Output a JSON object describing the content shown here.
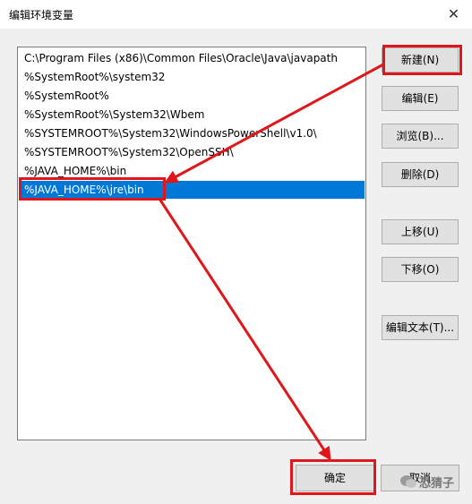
{
  "window": {
    "title": "编辑环境变量",
    "close_glyph": "✕"
  },
  "list": {
    "items": [
      "C:\\Program Files (x86)\\Common Files\\Oracle\\Java\\javapath",
      "%SystemRoot%\\system32",
      "%SystemRoot%",
      "%SystemRoot%\\System32\\Wbem",
      "%SYSTEMROOT%\\System32\\WindowsPowerShell\\v1.0\\",
      "%SYSTEMROOT%\\System32\\OpenSSH\\",
      "%JAVA_HOME%\\bin",
      "%JAVA_HOME%\\jre\\bin"
    ],
    "selected_index": 7
  },
  "buttons": {
    "new": "新建(N)",
    "edit": "编辑(E)",
    "browse": "浏览(B)...",
    "delete": "删除(D)",
    "move_up": "上移(U)",
    "move_down": "下移(O)",
    "edit_text": "编辑文本(T)...",
    "ok": "确定",
    "cancel": "取消"
  },
  "watermark": {
    "text": "恐猜子"
  },
  "colors": {
    "accent": "#e0161b",
    "selection": "#0078d7"
  }
}
